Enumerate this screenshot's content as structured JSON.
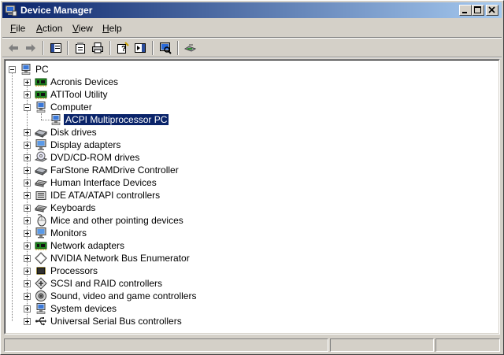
{
  "window": {
    "title": "Device Manager",
    "colors": {
      "titlebar_start": "#0a246a",
      "titlebar_end": "#a6caf0",
      "face": "#d4d0c8",
      "selection": "#0a246a"
    }
  },
  "menu": [
    {
      "key": "F",
      "rest": "ile"
    },
    {
      "key": "A",
      "rest": "ction"
    },
    {
      "key": "V",
      "rest": "iew"
    },
    {
      "key": "H",
      "rest": "elp"
    }
  ],
  "toolbar": [
    "back-arrow-icon",
    "forward-arrow-icon",
    "show-hide-console-tree-icon",
    "properties-icon",
    "print-icon",
    "help-icon",
    "show-hide-action-pane-icon",
    "scan-hardware-icon",
    "update-driver-icon"
  ],
  "tree": {
    "root": {
      "label": "PC",
      "icon": "computer-icon",
      "expanded": true
    },
    "categories": [
      {
        "label": "Acronis Devices",
        "icon": "chip-icon",
        "expanded": false
      },
      {
        "label": "ATITool Utility",
        "icon": "chip-icon",
        "expanded": false
      },
      {
        "label": "Computer",
        "icon": "computer-icon",
        "expanded": true,
        "children": [
          {
            "label": "ACPI Multiprocessor PC",
            "icon": "computer-icon",
            "selected": true
          }
        ]
      },
      {
        "label": "Disk drives",
        "icon": "disk-drive-icon",
        "expanded": false
      },
      {
        "label": "Display adapters",
        "icon": "monitor-icon",
        "expanded": false
      },
      {
        "label": "DVD/CD-ROM drives",
        "icon": "cd-icon",
        "expanded": false
      },
      {
        "label": "FarStone RAMDrive Controller",
        "icon": "disk-drive-icon",
        "expanded": false
      },
      {
        "label": "Human Interface Devices",
        "icon": "keyboard-icon",
        "expanded": false
      },
      {
        "label": "IDE ATA/ATAPI controllers",
        "icon": "ide-controller-icon",
        "expanded": false
      },
      {
        "label": "Keyboards",
        "icon": "keyboard-icon",
        "expanded": false
      },
      {
        "label": "Mice and other pointing devices",
        "icon": "mouse-icon",
        "expanded": false
      },
      {
        "label": "Monitors",
        "icon": "monitor-icon",
        "expanded": false
      },
      {
        "label": "Network adapters",
        "icon": "chip-icon",
        "expanded": false
      },
      {
        "label": "NVIDIA Network Bus Enumerator",
        "icon": "diamond-icon",
        "expanded": false
      },
      {
        "label": "Processors",
        "icon": "processor-icon",
        "expanded": false
      },
      {
        "label": "SCSI and RAID controllers",
        "icon": "scsi-icon",
        "expanded": false
      },
      {
        "label": "Sound, video and game controllers",
        "icon": "speaker-icon",
        "expanded": false
      },
      {
        "label": "System devices",
        "icon": "computer-icon",
        "expanded": false
      },
      {
        "label": "Universal Serial Bus controllers",
        "icon": "usb-icon",
        "expanded": false
      }
    ]
  },
  "statusbar": {
    "panes": [
      "",
      "",
      ""
    ]
  }
}
